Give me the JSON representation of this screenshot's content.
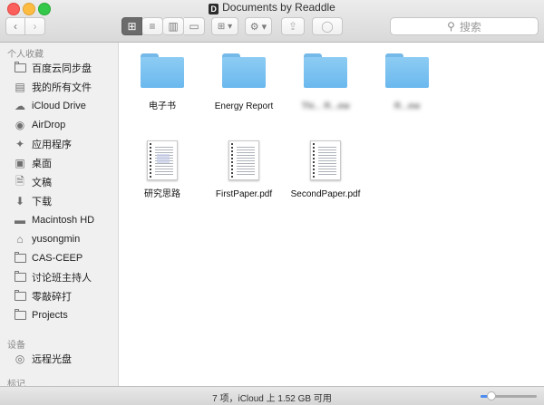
{
  "window": {
    "title": "Documents by Readdle",
    "title_icon_letter": "D"
  },
  "toolbar": {
    "back_icon": "‹",
    "forward_icon": "›",
    "view_icons": [
      "⊞",
      "≡",
      "▥",
      "▭"
    ],
    "arrange_icon": "⊞ ▾",
    "action_icon": "⚙ ▾",
    "share_icon": "⇪",
    "tag_icon": "◯",
    "search_placeholder": "搜索"
  },
  "sidebar": {
    "favorites_header": "个人收藏",
    "favorites": [
      {
        "label": "百度云同步盘",
        "icon": "folder-icon"
      },
      {
        "label": "我的所有文件",
        "icon": "all-files-icon"
      },
      {
        "label": "iCloud Drive",
        "icon": "cloud-icon"
      },
      {
        "label": "AirDrop",
        "icon": "airdrop-icon"
      },
      {
        "label": "应用程序",
        "icon": "applications-icon"
      },
      {
        "label": "桌面",
        "icon": "desktop-icon"
      },
      {
        "label": "文稿",
        "icon": "documents-icon"
      },
      {
        "label": "下载",
        "icon": "download-icon"
      },
      {
        "label": "Macintosh HD",
        "icon": "harddisk-icon"
      },
      {
        "label": "yusongmin",
        "icon": "home-icon"
      },
      {
        "label": "CAS-CEEP",
        "icon": "folder-icon"
      },
      {
        "label": "讨论班主持人",
        "icon": "folder-icon"
      },
      {
        "label": "零敲碎打",
        "icon": "folder-icon"
      },
      {
        "label": "Projects",
        "icon": "folder-icon"
      }
    ],
    "devices_header": "设备",
    "devices": [
      {
        "label": "远程光盘",
        "icon": "remote-disc-icon"
      }
    ],
    "tags_header": "标记"
  },
  "files": [
    {
      "name": "电子书",
      "kind": "folder"
    },
    {
      "name": "Energy Report",
      "kind": "folder"
    },
    {
      "name": "Thi... R...ew",
      "kind": "folder",
      "blurred": true
    },
    {
      "name": "R...ew",
      "kind": "folder",
      "blurred": true
    },
    {
      "name": "研究思路",
      "kind": "document"
    },
    {
      "name": "FirstPaper.pdf",
      "kind": "document"
    },
    {
      "name": "SecondPaper.pdf",
      "kind": "document"
    }
  ],
  "statusbar": {
    "text": "7 项，iCloud 上 1.52 GB 可用",
    "zoom_level": 0.2
  }
}
